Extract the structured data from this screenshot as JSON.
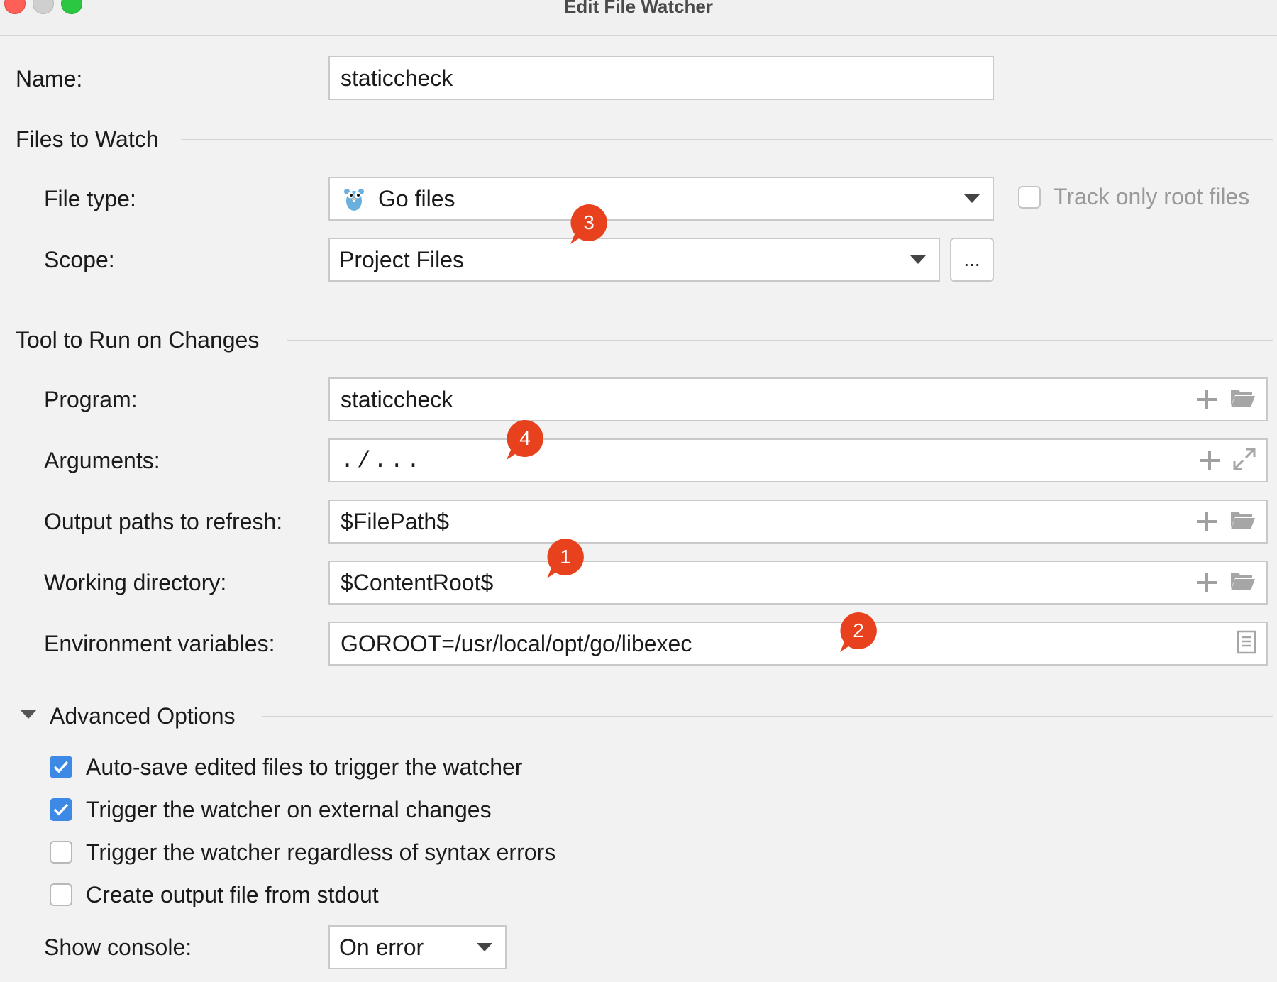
{
  "window": {
    "title": "Edit File Watcher"
  },
  "name": {
    "label": "Name:",
    "value": "staticcheck"
  },
  "files_to_watch": {
    "section": "Files to Watch",
    "file_type": {
      "label": "File type:",
      "value": "Go files",
      "icon": "gopher-icon"
    },
    "track_only_root": {
      "label": "Track only root files",
      "checked": false
    },
    "scope": {
      "label": "Scope:",
      "value": "Project Files",
      "more_button": "..."
    }
  },
  "tool": {
    "section": "Tool to Run on Changes",
    "program": {
      "label": "Program:",
      "value": "staticcheck"
    },
    "arguments": {
      "label": "Arguments:",
      "value": "./..."
    },
    "output_paths": {
      "label": "Output paths to refresh:",
      "value": "$FilePath$"
    },
    "working_dir": {
      "label": "Working directory:",
      "value": "$ContentRoot$"
    },
    "env_vars": {
      "label": "Environment variables:",
      "value": "GOROOT=/usr/local/opt/go/libexec"
    }
  },
  "advanced": {
    "section": "Advanced Options",
    "options": [
      {
        "label": "Auto-save edited files to trigger the watcher",
        "checked": true
      },
      {
        "label": "Trigger the watcher on external changes",
        "checked": true
      },
      {
        "label": "Trigger the watcher regardless of syntax errors",
        "checked": false
      },
      {
        "label": "Create output file from stdout",
        "checked": false
      }
    ],
    "show_console": {
      "label": "Show console:",
      "value": "On error"
    }
  },
  "callouts": [
    "3",
    "4",
    "1",
    "2"
  ],
  "colors": {
    "callout": "#e8411d",
    "checkbox_checked": "#3d8ae6",
    "background": "#f2f2f2"
  }
}
